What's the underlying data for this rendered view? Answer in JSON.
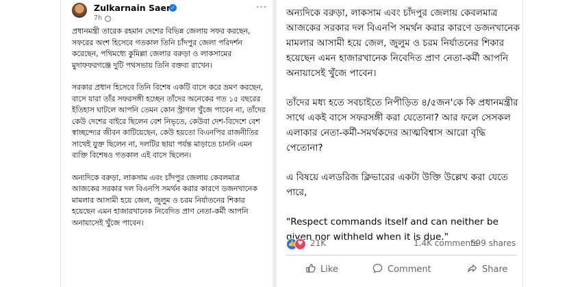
{
  "left_post": {
    "author": "Zulkarnain Saer",
    "time": "7h",
    "paragraphs": [
      "প্রধানমন্ত্রী তারেক রহমান দেশের বিভিন্ন জেলায় সফর করছেন, সফরের অংশ হিসেবে গতকাল তিনি চাঁদপুর জেলা পরিদর্শন করেছেন, পথিমধ্যে কুমিল্লা জেলার বরুড়া ও লাকসামের মুদাফফরগঞ্জে দুটি পথসভায় তিনি বক্তব্য রাখেন।",
      "সরকার প্রধান হিসেবে তিনি বিশেষ একটি বাসে করে ভ্রমণ করছেন, বাসে যারা তাঁর সফরসঙ্গী হচ্ছেন তাঁদের অনেকের গত ১৫ বছরের ইতিহাস ঘাটলে আপনি তেমন কোন স্ট্রাগল খুঁজে পাবেন না, তাঁদের কেউ দেশের বাইরে ছিলেন বেশ নিভৃতে, কেউবা দেশ-বিদেশে বেশ স্বাচ্ছন্দ্যের জীবন কাটিয়েছেন, কেউ হয়তো বিএনপির রাজনীতির সাথেই যুক্ত ছিলেন না, দলটির ছায়া পর্যন্ত মাড়াতে চাননি এমন ব্যক্তি বিশেষও গতকাল এই বাসে ছিলেন।",
      "অন্যদিকে বরুড়া, লাকসাম এবং চাঁদপুর জেলায় কেবলমাত্র আজকের সরকার দল বিএনপি সমর্থন করার কারণে ডজনখানেক মামলার আসামী হয়ে জেল, জুলুম ও চরম নির্যাতনের শিকার হয়েছেন এমন হাজারখানেক নিবেদিত প্রাণ নেতা-কর্মী আপনি অনায়াসেই খুঁজে পাবেন।"
    ]
  },
  "right_post": {
    "paragraphs": [
      "অন্যদিকে বরুড়া, লাকসাম এবং চাঁদপুর জেলায় কেবলমাত্র আজকের সরকার দল বিএনপি সমর্থন করার কারণে ডজনখানেক মামলার আসামী হয়ে জেল, জুলুম ও চরম নির্যাতনের শিকার হয়েছেন এমন হাজারখানেক নিবেদিত প্রাণ নেতা-কর্মী আপনি অনায়াসেই খুঁজে পাবেন।",
      "তাঁদের মধ্য হতে সবচাইতে নিপীড়িত ৪/৫জন'কে কি প্রধানমন্ত্রীর সাথে একই বাসে সফরসঙ্গী করা যেতোনা? আর ফলে সেসকল এলাকার নেতা-কর্মী-সমর্থকদের আত্মবিশ্বাস আরো বৃদ্ধি পেতোনা?",
      "এ বিষয়ে এলডরিজ ক্লিভারের একটা উক্তি উল্লেখ করা যেতে পারে,"
    ],
    "quote": "\"Respect commands itself and can neither be given nor withheld when it is due.\"",
    "reactions": "21K",
    "comments": "1.4K comments",
    "shares": "599 shares",
    "actions": {
      "like": "Like",
      "comment": "Comment",
      "share": "Share"
    }
  },
  "icons": [
    "avatar",
    "verified-icon",
    "globe-icon",
    "more-icon",
    "like-reaction-icon",
    "love-reaction-icon",
    "thumbs-up-icon",
    "comment-icon",
    "share-icon"
  ],
  "colors": {
    "accent": "#1877f2",
    "love": "#f33e58",
    "secondary_text": "#65676b"
  }
}
